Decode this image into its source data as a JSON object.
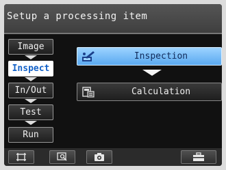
{
  "title": "Setup a processing item",
  "sidebar": {
    "items": [
      {
        "label": "Image",
        "active": false
      },
      {
        "label": "Inspect",
        "active": true
      },
      {
        "label": "In/Out",
        "active": false
      },
      {
        "label": "Test",
        "active": false
      },
      {
        "label": "Run",
        "active": false
      }
    ]
  },
  "main": {
    "items": [
      {
        "label": "Inspection",
        "icon": "inspection-icon",
        "selected": true
      },
      {
        "label": "Calculation",
        "icon": "calculation-icon",
        "selected": false
      }
    ]
  },
  "toolbar": {
    "buttons": [
      {
        "icon": "frame-icon"
      },
      {
        "icon": "zoom-icon"
      },
      {
        "icon": "camera-icon"
      },
      {
        "icon": "toolbox-icon"
      }
    ]
  },
  "colors": {
    "selected_item": "#5aa9f0",
    "active_tab_text": "#1462c8",
    "background": "#111111"
  }
}
